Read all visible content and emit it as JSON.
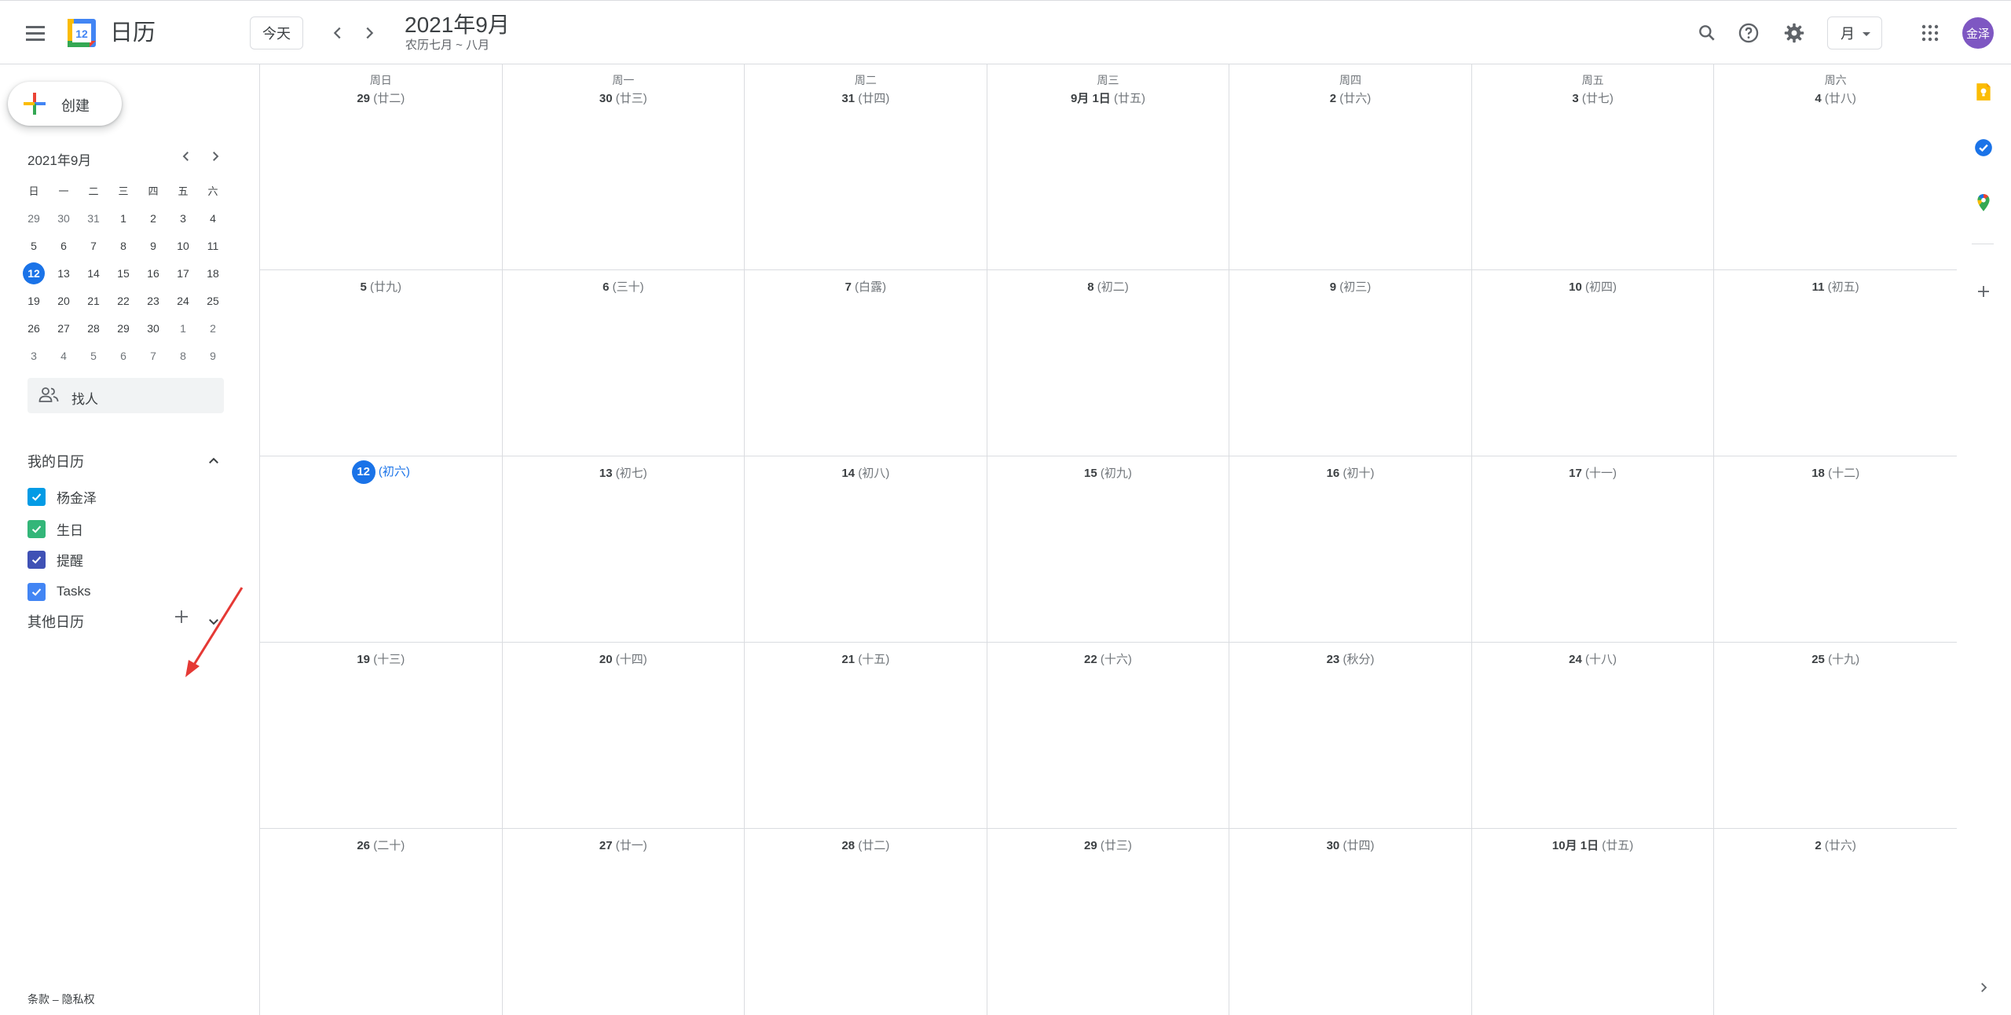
{
  "header": {
    "app_name": "日历",
    "logo_day": "12",
    "today_button": "今天",
    "month_title": "2021年9月",
    "lunar_range": "农历七月 ~ 八月",
    "view_select": "月",
    "avatar_text": "金泽"
  },
  "sidebar": {
    "create_button": "创建",
    "mini_calendar": {
      "title": "2021年9月",
      "weekdays": [
        "日",
        "一",
        "二",
        "三",
        "四",
        "五",
        "六"
      ],
      "weeks": [
        [
          "29",
          "30",
          "31",
          "1",
          "2",
          "3",
          "4"
        ],
        [
          "5",
          "6",
          "7",
          "8",
          "9",
          "10",
          "11"
        ],
        [
          "12",
          "13",
          "14",
          "15",
          "16",
          "17",
          "18"
        ],
        [
          "19",
          "20",
          "21",
          "22",
          "23",
          "24",
          "25"
        ],
        [
          "26",
          "27",
          "28",
          "29",
          "30",
          "1",
          "2"
        ],
        [
          "3",
          "4",
          "5",
          "6",
          "7",
          "8",
          "9"
        ]
      ],
      "today": "12"
    },
    "find_people": "找人",
    "my_calendars_title": "我的日历",
    "my_calendars": [
      {
        "name": "杨金泽",
        "color": "#039be5"
      },
      {
        "name": "生日",
        "color": "#33b679"
      },
      {
        "name": "提醒",
        "color": "#3f51b5"
      },
      {
        "name": "Tasks",
        "color": "#4285f4"
      }
    ],
    "other_calendars_title": "其他日历",
    "footer_terms": "条款",
    "footer_sep": " – ",
    "footer_privacy": "隐私权"
  },
  "grid": {
    "weekdays": [
      "周日",
      "周一",
      "周二",
      "周三",
      "周四",
      "周五",
      "周六"
    ],
    "weeks": [
      [
        {
          "num": "29",
          "lunar": "(廿二)"
        },
        {
          "num": "30",
          "lunar": "(廿三)"
        },
        {
          "num": "31",
          "lunar": "(廿四)"
        },
        {
          "num": "9月 1日",
          "lunar": "(廿五)"
        },
        {
          "num": "2",
          "lunar": "(廿六)"
        },
        {
          "num": "3",
          "lunar": "(廿七)"
        },
        {
          "num": "4",
          "lunar": "(廿八)"
        }
      ],
      [
        {
          "num": "5",
          "lunar": "(廿九)"
        },
        {
          "num": "6",
          "lunar": "(三十)"
        },
        {
          "num": "7",
          "lunar": "(白露)"
        },
        {
          "num": "8",
          "lunar": "(初二)"
        },
        {
          "num": "9",
          "lunar": "(初三)"
        },
        {
          "num": "10",
          "lunar": "(初四)"
        },
        {
          "num": "11",
          "lunar": "(初五)"
        }
      ],
      [
        {
          "num": "12",
          "lunar": "(初六)",
          "today": true
        },
        {
          "num": "13",
          "lunar": "(初七)"
        },
        {
          "num": "14",
          "lunar": "(初八)"
        },
        {
          "num": "15",
          "lunar": "(初九)"
        },
        {
          "num": "16",
          "lunar": "(初十)"
        },
        {
          "num": "17",
          "lunar": "(十一)"
        },
        {
          "num": "18",
          "lunar": "(十二)"
        }
      ],
      [
        {
          "num": "19",
          "lunar": "(十三)"
        },
        {
          "num": "20",
          "lunar": "(十四)"
        },
        {
          "num": "21",
          "lunar": "(十五)"
        },
        {
          "num": "22",
          "lunar": "(十六)"
        },
        {
          "num": "23",
          "lunar": "(秋分)"
        },
        {
          "num": "24",
          "lunar": "(十八)"
        },
        {
          "num": "25",
          "lunar": "(十九)"
        }
      ],
      [
        {
          "num": "26",
          "lunar": "(二十)"
        },
        {
          "num": "27",
          "lunar": "(廿一)"
        },
        {
          "num": "28",
          "lunar": "(廿二)"
        },
        {
          "num": "29",
          "lunar": "(廿三)"
        },
        {
          "num": "30",
          "lunar": "(廿四)"
        },
        {
          "num": "10月 1日",
          "lunar": "(廿五)"
        },
        {
          "num": "2",
          "lunar": "(廿六)"
        }
      ]
    ]
  },
  "side_panel": {
    "icons": [
      "keep-icon",
      "tasks-icon",
      "maps-icon",
      "add-addon-icon",
      "expand-panel-icon"
    ]
  },
  "colors": {
    "accent": "#1a73e8",
    "avatar": "#7e57c2",
    "annotation_arrow": "#e53935"
  }
}
